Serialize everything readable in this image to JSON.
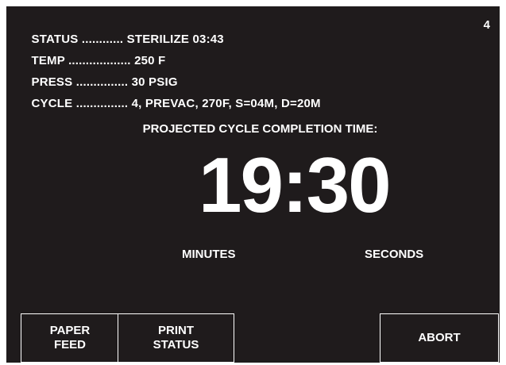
{
  "status_lines": [
    {
      "key": "STATUS",
      "dots": "............",
      "value": "STERILIZE 03:43"
    },
    {
      "key": "TEMP",
      "dots": "..................",
      "value": "250 F"
    },
    {
      "key": "PRESS",
      "dots": "...............",
      "value": "30 PSIG"
    },
    {
      "key": "CYCLE",
      "dots": "...............",
      "value": "4, PREVAC, 270F, S=04M, D=20M"
    }
  ],
  "corner_number": "4",
  "projected_label": "PROJECTED CYCLE COMPLETION TIME:",
  "timer": "19:30",
  "units": {
    "minutes": "MINUTES",
    "seconds": "SECONDS"
  },
  "buttons": {
    "paper_feed": [
      "PAPER",
      "FEED"
    ],
    "print_status": [
      "PRINT",
      "STATUS"
    ],
    "abort": "ABORT"
  },
  "colors": {
    "screen_background": "#1f1b1c",
    "text": "#ffffff"
  }
}
